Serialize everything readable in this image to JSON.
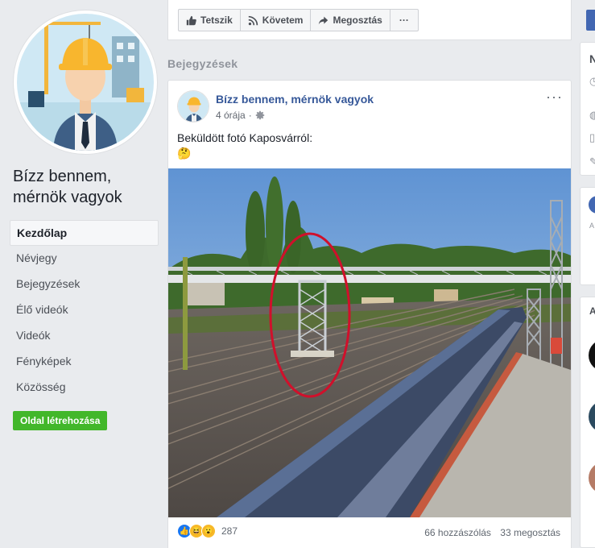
{
  "page": {
    "name": "Bízz bennem, mérnök vagyok",
    "nav": [
      "Kezdőlap",
      "Névjegy",
      "Bejegyzések",
      "Élő videók",
      "Videók",
      "Fényképek",
      "Közösség"
    ],
    "create_page_label": "Oldal létrehozása"
  },
  "actions": {
    "like_label": "Tetszik",
    "follow_label": "Követem",
    "share_label": "Megosztás",
    "more_label": "···"
  },
  "feed": {
    "section_title": "Bejegyzések"
  },
  "post": {
    "author": "Bízz bennem, mérnök vagyok",
    "time": "4 órája",
    "text": "Beküldött fotó Kaposvárról:",
    "emoji": "🤔",
    "reaction_count": "287",
    "comments": "66 hozzászólás",
    "shares": "33 megosztás",
    "menu": "···"
  },
  "right_sidebar": {
    "visible_letters": [
      "N",
      "A",
      "A"
    ]
  },
  "colors": {
    "link": "#365899",
    "green": "#42b72a",
    "blue": "#4267b2",
    "highlight_circle": "#d0102b"
  },
  "icons": [
    "thumbs-up-icon",
    "rss-icon",
    "share-arrow-icon",
    "gear-icon",
    "more-dots-icon"
  ]
}
